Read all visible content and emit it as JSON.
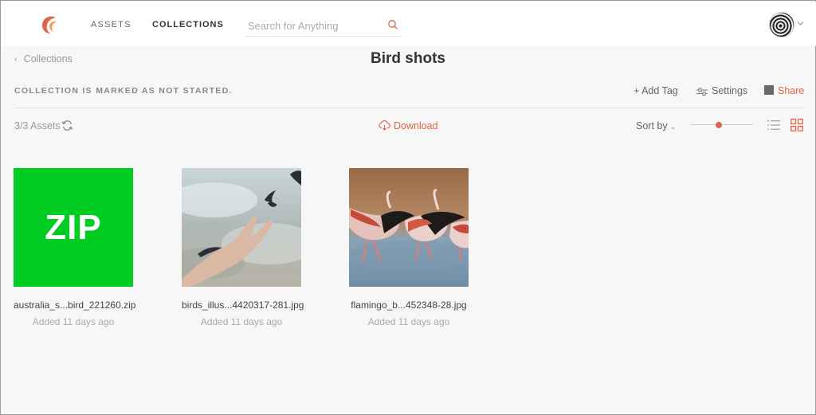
{
  "nav": {
    "assets_label": "ASSETS",
    "collections_label": "COLLECTIONS",
    "search_placeholder": "Search for Anything"
  },
  "header": {
    "back_label": "Collections",
    "title": "Bird shots"
  },
  "status": {
    "text": "COLLECTION IS MARKED AS NOT STARTED."
  },
  "actions": {
    "add_tag": "+ Add Tag",
    "settings": "Settings",
    "share": "Share"
  },
  "toolbar": {
    "asset_count": "3/3 Assets",
    "download": "Download",
    "sort_by": "Sort by",
    "thumbnail_size": 0.45
  },
  "assets": [
    {
      "name": "australia_s...bird_221260.zip",
      "added": "Added 11 days ago",
      "thumb_label": "ZIP"
    },
    {
      "name": "birds_illus...4420317-281.jpg",
      "added": "Added 11 days ago"
    },
    {
      "name": "flamingo_b...452348-28.jpg",
      "added": "Added 11 days ago"
    }
  ],
  "colors": {
    "accent": "#e0644c",
    "zip_green": "#00cc22"
  }
}
